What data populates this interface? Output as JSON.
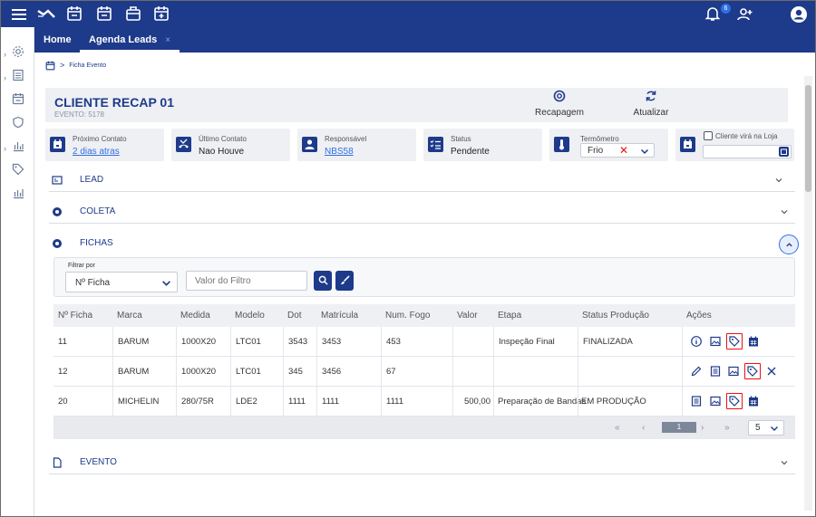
{
  "colors": {
    "brand": "#1e3a8a",
    "link": "#2f6fe4",
    "highlight": "#ee1111"
  },
  "topbar": {
    "icons": [
      "menu-icon",
      "logo-icon",
      "calendar-icon",
      "calendar-check-icon",
      "briefcase-icon",
      "calendar-plus-icon",
      "bell-icon",
      "user-plus-icon",
      "account-icon"
    ],
    "notifications": "6"
  },
  "leftnav": {
    "icons": [
      "settings-icon",
      "list-icon",
      "calendar-icon",
      "shield-icon",
      "bar-chart-icon",
      "tag-icon",
      "chart-icon"
    ]
  },
  "tabs": [
    {
      "label": "Home",
      "active": false
    },
    {
      "label": "Agenda Leads",
      "active": true,
      "close": "×"
    }
  ],
  "breadcrumb": {
    "sep": ">",
    "label": "Ficha Evento"
  },
  "header": {
    "title": "CLIENTE RECAP 01",
    "subtitle": "EVENTO: 5178",
    "actions": [
      {
        "label": "Recapagem",
        "icon": "tire-icon"
      },
      {
        "label": "Atualizar",
        "icon": "refresh-icon"
      }
    ]
  },
  "info": {
    "proximo": {
      "label": "Próximo Contato",
      "value": "2 dias atras"
    },
    "ultimo": {
      "label": "Último Contato",
      "value": "Nao Houve"
    },
    "responsavel": {
      "label": "Responsável",
      "value": "NBS58"
    },
    "status": {
      "label": "Status",
      "value": "Pendente"
    },
    "termometro": {
      "label": "Termômetro",
      "value": "Frio",
      "clear": "✕"
    },
    "loja": {
      "label": "Cliente virá na Loja"
    }
  },
  "sections": {
    "lead": "LEAD",
    "coleta": "COLETA",
    "fichas": "FICHAS",
    "evento": "EVENTO"
  },
  "filter": {
    "label": "Filtrar por",
    "select": "Nº Ficha",
    "placeholder": "Valor do Filtro"
  },
  "grid": {
    "headers": [
      "Nº Ficha",
      "Marca",
      "Medida",
      "Modelo",
      "Dot",
      "Matrícula",
      "Num. Fogo",
      "Valor",
      "Etapa",
      "Status Produção",
      "Ações"
    ],
    "rows": [
      {
        "ficha": "11",
        "marca": "BARUM",
        "medida": "1000X20",
        "modelo": "LTC01",
        "dot": "3543",
        "matricula": "3453",
        "fogo": "453",
        "valor": "",
        "etapa": "Inspeção Final",
        "status": "FINALIZADA",
        "actions": [
          "info-icon",
          "image-icon",
          "tag-icon",
          "calendar-icon"
        ]
      },
      {
        "ficha": "12",
        "marca": "BARUM",
        "medida": "1000X20",
        "modelo": "LTC01",
        "dot": "345",
        "matricula": "3456",
        "fogo": "67",
        "valor": "",
        "etapa": "",
        "status": "",
        "actions": [
          "edit-icon",
          "document-icon",
          "image-icon",
          "tag-icon",
          "close-icon"
        ]
      },
      {
        "ficha": "20",
        "marca": "MICHELIN",
        "medida": "280/75R",
        "modelo": "LDE2",
        "dot": "1111",
        "matricula": "1111",
        "fogo": "1111",
        "valor": "500,00",
        "etapa": "Preparação de Bandas",
        "status": "EM PRODUÇÃO",
        "actions": [
          "document-icon",
          "image-icon",
          "tag-icon",
          "calendar-icon"
        ]
      }
    ],
    "pagination": {
      "first": "«",
      "prev": "‹",
      "current": "1",
      "next": "›",
      "last": "»",
      "page_size": "5"
    }
  }
}
